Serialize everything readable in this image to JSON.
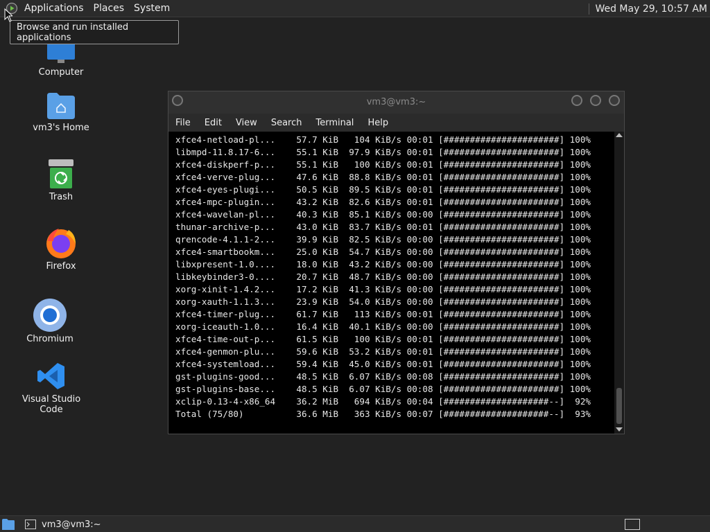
{
  "top_panel": {
    "menus": [
      "Applications",
      "Places",
      "System"
    ],
    "clock": "Wed May 29, 10:57 AM"
  },
  "tooltip": "Browse and run installed applications",
  "desktop_icons": [
    {
      "label": "Computer",
      "icon": "monitor-icon"
    },
    {
      "label": "vm3's Home",
      "icon": "home-folder-icon"
    },
    {
      "label": "Trash",
      "icon": "trash-icon"
    },
    {
      "label": "Firefox",
      "icon": "firefox-icon"
    },
    {
      "label": "Chromium",
      "icon": "chromium-icon"
    },
    {
      "label": "Visual Studio Code",
      "icon": "vscode-icon"
    }
  ],
  "terminal": {
    "title": "vm3@vm3:~",
    "menu": [
      "File",
      "Edit",
      "View",
      "Search",
      "Terminal",
      "Help"
    ],
    "lines": [
      "xfce4-netload-pl...    57.7 KiB   104 KiB/s 00:01 [######################] 100%",
      "libmpd-11.8.17-6...    55.1 KiB  97.9 KiB/s 00:01 [######################] 100%",
      "xfce4-diskperf-p...    55.1 KiB   100 KiB/s 00:01 [######################] 100%",
      "xfce4-verve-plug...    47.6 KiB  88.8 KiB/s 00:01 [######################] 100%",
      "xfce4-eyes-plugi...    50.5 KiB  89.5 KiB/s 00:01 [######################] 100%",
      "xfce4-mpc-plugin...    43.2 KiB  82.6 KiB/s 00:01 [######################] 100%",
      "xfce4-wavelan-pl...    40.3 KiB  85.1 KiB/s 00:00 [######################] 100%",
      "thunar-archive-p...    43.0 KiB  83.7 KiB/s 00:01 [######################] 100%",
      "qrencode-4.1.1-2...    39.9 KiB  82.5 KiB/s 00:00 [######################] 100%",
      "xfce4-smartbookm...    25.0 KiB  54.7 KiB/s 00:00 [######################] 100%",
      "libxpresent-1.0....    18.0 KiB  43.2 KiB/s 00:00 [######################] 100%",
      "libkeybinder3-0....    20.7 KiB  48.7 KiB/s 00:00 [######################] 100%",
      "xorg-xinit-1.4.2...    17.2 KiB  41.3 KiB/s 00:00 [######################] 100%",
      "xorg-xauth-1.1.3...    23.9 KiB  54.0 KiB/s 00:00 [######################] 100%",
      "xfce4-timer-plug...    61.7 KiB   113 KiB/s 00:01 [######################] 100%",
      "xorg-iceauth-1.0...    16.4 KiB  40.1 KiB/s 00:00 [######################] 100%",
      "xfce4-time-out-p...    61.5 KiB   100 KiB/s 00:01 [######################] 100%",
      "xfce4-genmon-plu...    59.6 KiB  53.2 KiB/s 00:01 [######################] 100%",
      "xfce4-systemload...    59.4 KiB  45.0 KiB/s 00:01 [######################] 100%",
      "gst-plugins-good...    48.5 KiB  6.07 KiB/s 00:08 [######################] 100%",
      "gst-plugins-base...    48.5 KiB  6.07 KiB/s 00:08 [######################] 100%",
      "xclip-0.13-4-x86_64    36.2 MiB   694 KiB/s 00:04 [####################--]  92%",
      "Total (75/80)          36.6 MiB   363 KiB/s 00:07 [####################--]  93%"
    ]
  },
  "taskbar": {
    "task_label": "vm3@vm3:~"
  }
}
